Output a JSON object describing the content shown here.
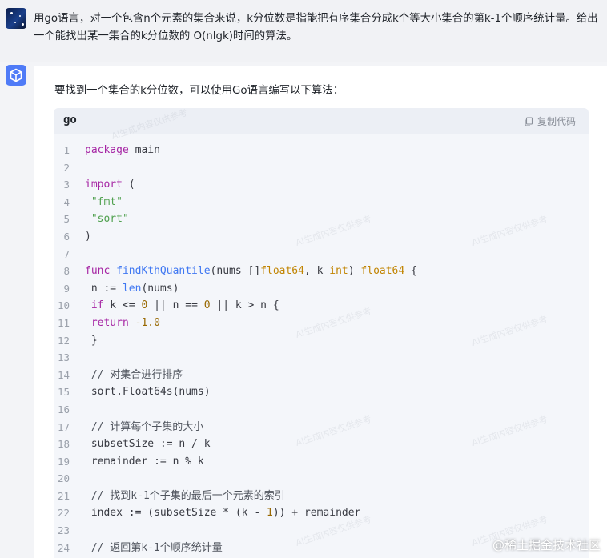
{
  "user_message": {
    "text": "用go语言，对一个包含n个元素的集合来说，k分位数是指能把有序集合分成k个等大小集合的第k-1个顺序统计量。给出一个能找出某一集合的k分位数的 O(nlgk)时间的算法。"
  },
  "answer": {
    "intro": "要找到一个集合的k分位数，可以使用Go语言编写以下算法：",
    "code_block": {
      "language": "go",
      "copy_label": "复制代码",
      "lines": [
        "package main",
        "",
        "import (",
        " \"fmt\"",
        " \"sort\"",
        ")",
        "",
        "func findKthQuantile(nums []float64, k int) float64 {",
        " n := len(nums)",
        " if k <= 0 || n == 0 || k > n {",
        " return -1.0",
        " }",
        "",
        " // 对集合进行排序",
        " sort.Float64s(nums)",
        "",
        " // 计算每个子集的大小",
        " subsetSize := n / k",
        " remainder := n % k",
        "",
        " // 找到k-1个子集的最后一个元素的索引",
        " index := (subsetSize * (k - 1)) + remainder",
        "",
        " // 返回第k-1个顺序统计量"
      ]
    }
  },
  "watermark_text": "AI生成内容仅供参考",
  "footer_brand": "@稀土掘金技术社区",
  "colors": {
    "accent": "#4f7bf7",
    "keyword": "#a626a4",
    "function": "#4078f2",
    "string": "#50a14f",
    "number": "#986801"
  }
}
